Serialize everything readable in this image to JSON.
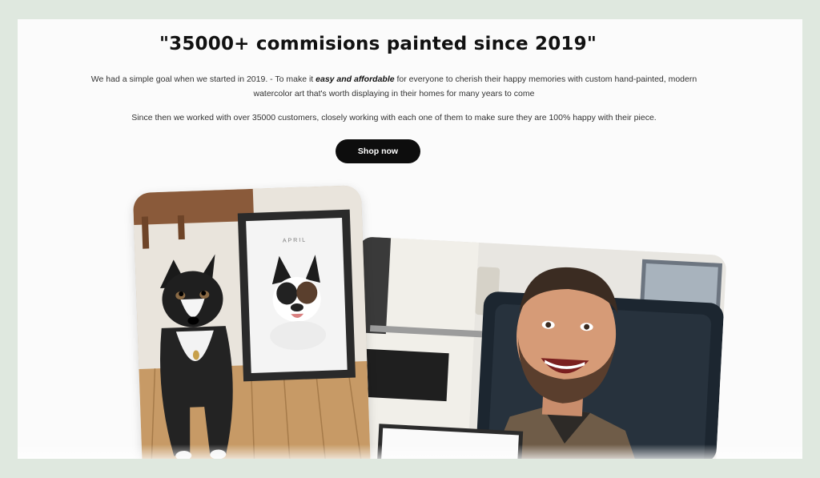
{
  "headline": "\"35000+ commisions painted since 2019\"",
  "intro": {
    "before": "We had a simple goal when we started in 2019. - To make it ",
    "emphasis": "easy and affordable",
    "after": " for everyone to cherish their happy memories with custom hand-painted, modern watercolor art that's worth displaying in their homes for many years to come"
  },
  "intro2": "Since then we worked with over 35000 customers, closely working with each one of them to make sure they are 100% happy with their piece.",
  "shop_button": "Shop now",
  "dog_card": {
    "frame_caption": "APRIL"
  },
  "colors": {
    "background": "#dfe8df",
    "card": "#fbfbfb",
    "button": "#0d0d0d"
  }
}
